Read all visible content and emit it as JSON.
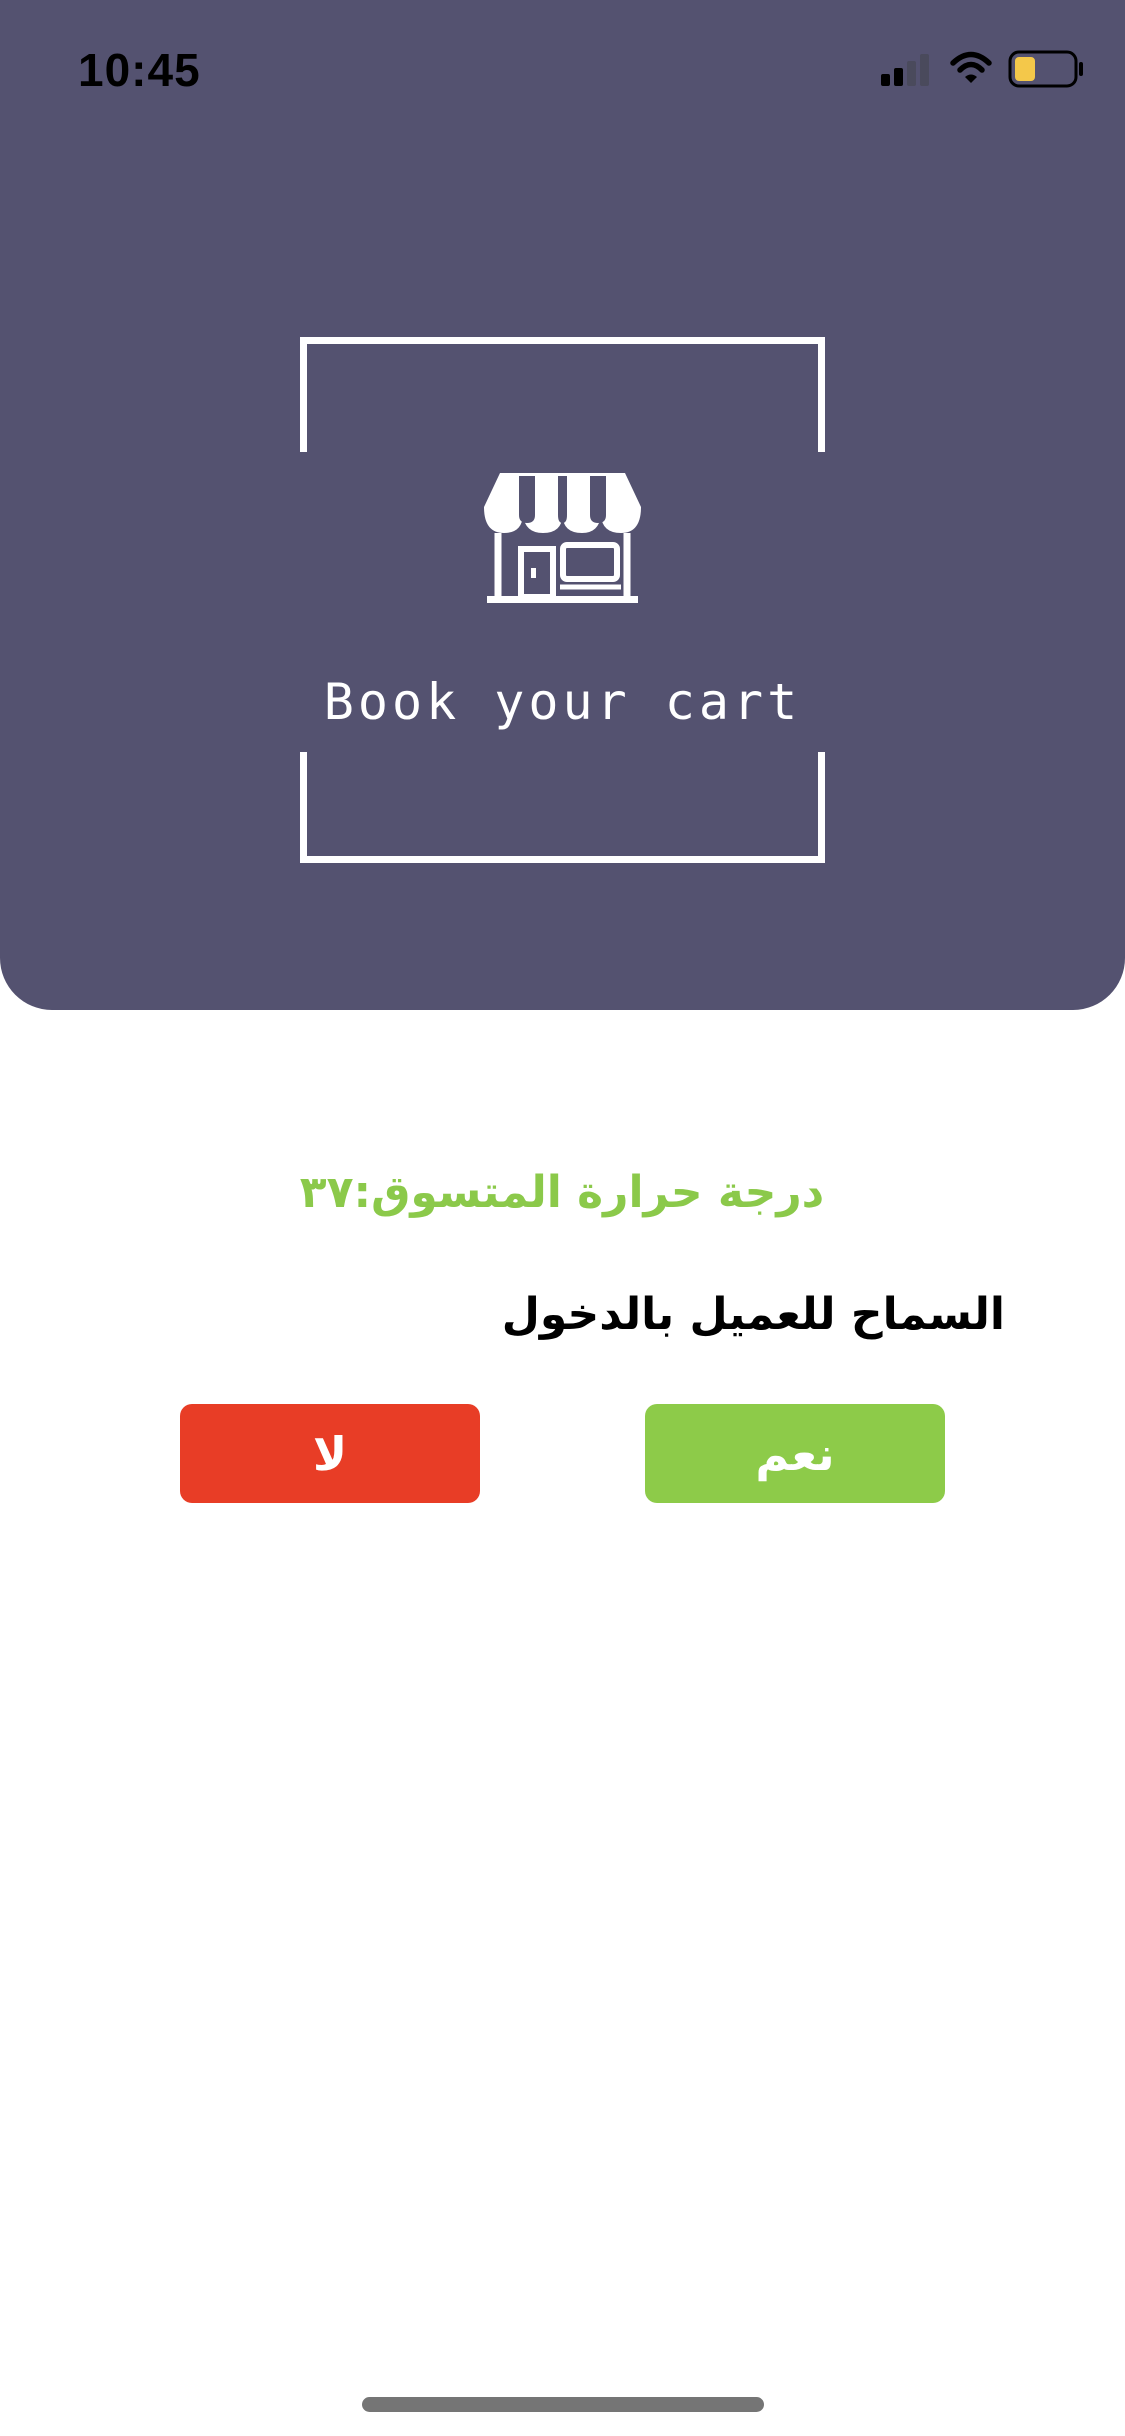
{
  "colors": {
    "header_bg": "#545270",
    "frame": "#ffffff",
    "temp_text": "#8bc94a",
    "yes_button": "#8dcb49",
    "no_button": "#e83d26",
    "battery_fill": "#f4c84a"
  },
  "status_bar": {
    "time": "10:45",
    "icons": [
      "cellular-signal-icon",
      "wifi-icon",
      "battery-icon"
    ]
  },
  "logo": {
    "icon": "store-icon",
    "brand": "Book your cart"
  },
  "content": {
    "temperature": "درجة حرارة المتسوق:٣٧",
    "question": "السماح للعميل بالدخول"
  },
  "buttons": {
    "yes_label": "نعم",
    "no_label": "لا"
  }
}
